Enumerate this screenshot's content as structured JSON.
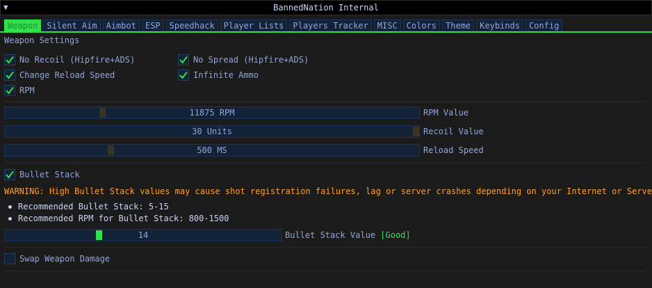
{
  "window": {
    "title": "BannedNation Internal",
    "collapse_icon": "triangle-down"
  },
  "tabs": [
    "Weapon",
    "Silent Aim",
    "Aimbot",
    "ESP",
    "Speedhack",
    "Player Lists",
    "Players Tracker",
    "MISC",
    "Colors",
    "Theme",
    "Keybinds",
    "Config"
  ],
  "active_tab": "Weapon",
  "section_title": "Weapon Settings",
  "checkboxes": {
    "no_recoil": {
      "label": "No Recoil (Hipfire+ADS)",
      "checked": true
    },
    "no_spread": {
      "label": "No Spread (Hipfire+ADS)",
      "checked": true
    },
    "reload_speed": {
      "label": "Change Reload Speed",
      "checked": true
    },
    "infinite_ammo": {
      "label": "Infinite Ammo",
      "checked": true
    },
    "rpm": {
      "label": "RPM",
      "checked": true
    },
    "bullet_stack": {
      "label": "Bullet Stack",
      "checked": true
    },
    "swap_damage": {
      "label": "Swap Weapon Damage",
      "checked": false
    }
  },
  "sliders": {
    "rpm": {
      "value_text": "11875 RPM",
      "label": "RPM Value"
    },
    "recoil": {
      "value_text": "30 Units",
      "label": "Recoil Value"
    },
    "reload": {
      "value_text": "500 MS",
      "label": "Reload Speed"
    },
    "bullet_stack": {
      "value_text": "14",
      "label": "Bullet Stack Value",
      "status": "[Good]"
    }
  },
  "warning": "WARNING: High Bullet Stack values may cause shot registration failures, lag or server crashes depending on your Internet or Server.",
  "recommendations": [
    "Recommended Bullet Stack: 5-15",
    "Recommended RPM for Bullet Stack: 800-1500"
  ],
  "colors": {
    "accent": "#2fe24c",
    "text": "#8fa6dd",
    "warning": "#ff9f2e",
    "frame": "#132236",
    "background": "#1b1b1b"
  }
}
